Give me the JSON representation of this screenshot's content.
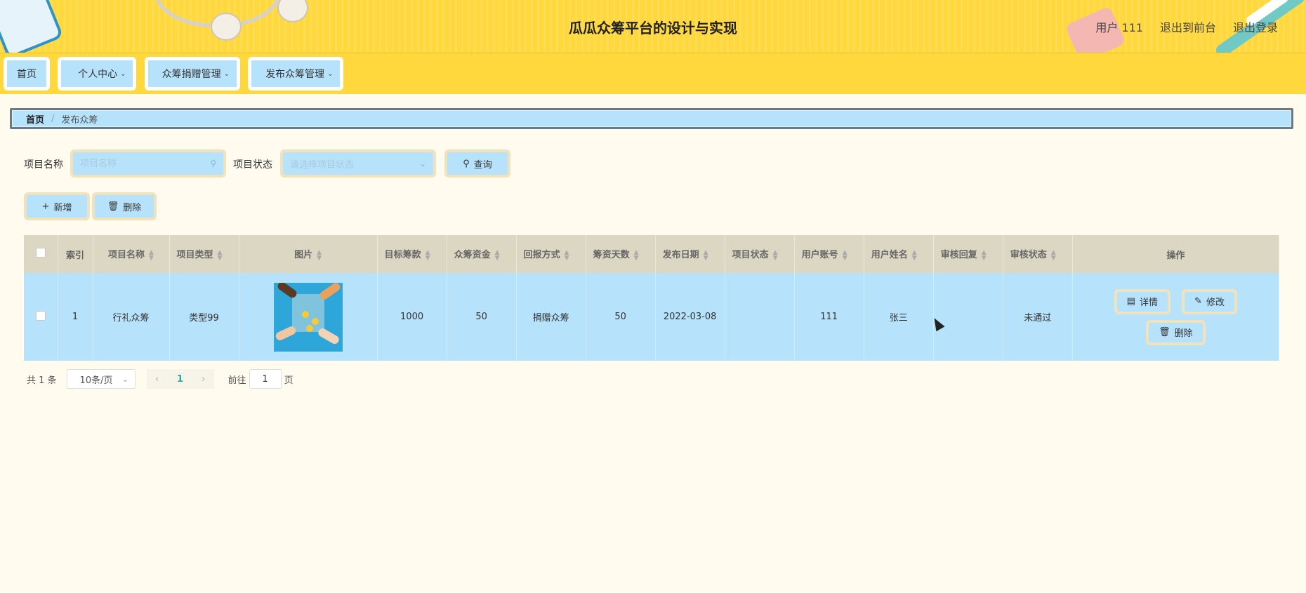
{
  "header": {
    "title": "瓜瓜众筹平台的设计与实现",
    "user": "用户 111",
    "to_front": "退出到前台",
    "logout": "退出登录"
  },
  "nav": [
    {
      "label": "首页",
      "dropdown": false
    },
    {
      "label": "个人中心",
      "dropdown": true
    },
    {
      "label": "众筹捐赠管理",
      "dropdown": true
    },
    {
      "label": "发布众筹管理",
      "dropdown": true
    }
  ],
  "breadcrumb": {
    "home": "首页",
    "sep": "/",
    "current": "发布众筹"
  },
  "search": {
    "name_label": "项目名称",
    "name_placeholder": "项目名称",
    "status_label": "项目状态",
    "status_placeholder": "请选择项目状态",
    "query": "查询"
  },
  "actions": {
    "add": "新增",
    "delete": "删除"
  },
  "table": {
    "headers": [
      "索引",
      "项目名称",
      "项目类型",
      "图片",
      "目标筹款",
      "众筹资金",
      "回报方式",
      "筹资天数",
      "发布日期",
      "项目状态",
      "用户账号",
      "用户姓名",
      "审核回复",
      "审核状态",
      "操作"
    ],
    "rows": [
      {
        "index": "1",
        "name": "行礼众筹",
        "type": "类型99",
        "target": "1000",
        "funds": "50",
        "return": "捐赠众筹",
        "days": "50",
        "date": "2022-03-08",
        "status": "",
        "account": "111",
        "username": "张三",
        "reply": "",
        "audit": "未通过",
        "ops": {
          "detail": "详情",
          "edit": "修改",
          "delete": "删除"
        }
      }
    ]
  },
  "pager": {
    "total": "共 1 条",
    "page_size": "10条/页",
    "current": "1",
    "goto_prefix": "前往",
    "goto_value": "1",
    "goto_suffix": "页"
  },
  "colors": {
    "header": "#ffd83e",
    "accent": "#b7e2fb",
    "frame": "#f0e2be",
    "background": "#fffbef"
  }
}
